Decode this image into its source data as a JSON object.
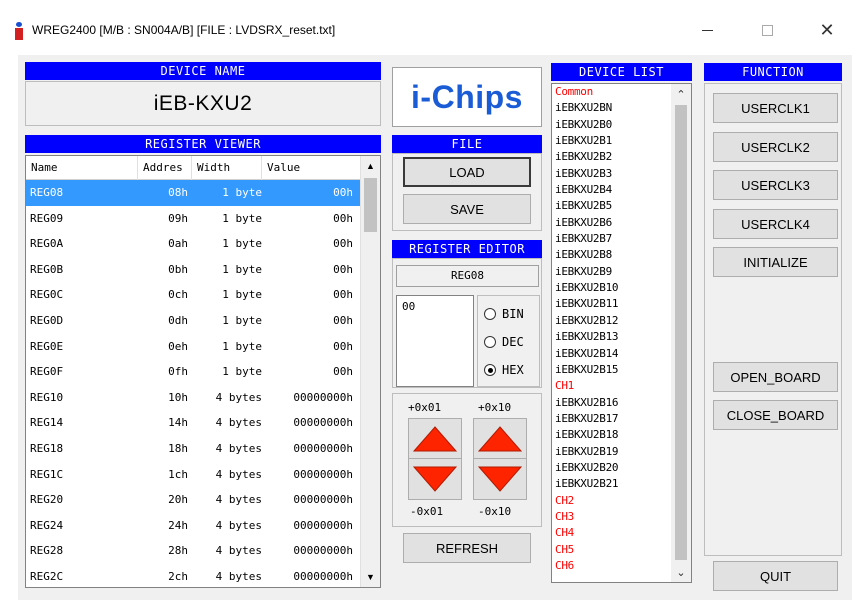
{
  "window": {
    "title": "WREG2400 [M/B : SN004A/B] [FILE : LVDSRX_reset.txt]",
    "minimize_glyph": "—",
    "maximize_glyph": "☐",
    "close_glyph": "✕"
  },
  "device_name": {
    "header": "DEVICE NAME",
    "value": "iEB-KXU2"
  },
  "logo": {
    "text": "i-Chips",
    "color": "#1a5bd6"
  },
  "register_viewer": {
    "header": "REGISTER VIEWER",
    "columns": [
      "Name",
      "Addres",
      "Width",
      "Value"
    ],
    "selected_index": 0,
    "rows": [
      {
        "name": "REG08",
        "addr": "08h",
        "width": "1 byte",
        "value": "00h"
      },
      {
        "name": "REG09",
        "addr": "09h",
        "width": "1 byte",
        "value": "00h"
      },
      {
        "name": "REG0A",
        "addr": "0ah",
        "width": "1 byte",
        "value": "00h"
      },
      {
        "name": "REG0B",
        "addr": "0bh",
        "width": "1 byte",
        "value": "00h"
      },
      {
        "name": "REG0C",
        "addr": "0ch",
        "width": "1 byte",
        "value": "00h"
      },
      {
        "name": "REG0D",
        "addr": "0dh",
        "width": "1 byte",
        "value": "00h"
      },
      {
        "name": "REG0E",
        "addr": "0eh",
        "width": "1 byte",
        "value": "00h"
      },
      {
        "name": "REG0F",
        "addr": "0fh",
        "width": "1 byte",
        "value": "00h"
      },
      {
        "name": "REG10",
        "addr": "10h",
        "width": "4 bytes",
        "value": "00000000h"
      },
      {
        "name": "REG14",
        "addr": "14h",
        "width": "4 bytes",
        "value": "00000000h"
      },
      {
        "name": "REG18",
        "addr": "18h",
        "width": "4 bytes",
        "value": "00000000h"
      },
      {
        "name": "REG1C",
        "addr": "1ch",
        "width": "4 bytes",
        "value": "00000000h"
      },
      {
        "name": "REG20",
        "addr": "20h",
        "width": "4 bytes",
        "value": "00000000h"
      },
      {
        "name": "REG24",
        "addr": "24h",
        "width": "4 bytes",
        "value": "00000000h"
      },
      {
        "name": "REG28",
        "addr": "28h",
        "width": "4 bytes",
        "value": "00000000h"
      },
      {
        "name": "REG2C",
        "addr": "2ch",
        "width": "4 bytes",
        "value": "00000000h"
      }
    ],
    "scroll_up_glyph": "▲",
    "scroll_down_glyph": "▼"
  },
  "file_panel": {
    "header": "FILE",
    "load_label": "LOAD",
    "save_label": "SAVE"
  },
  "register_editor": {
    "header": "REGISTER EDITOR",
    "register_name": "REG08",
    "edit_value": "00",
    "radix_options": [
      "BIN",
      "DEC",
      "HEX"
    ],
    "selected_radix": "HEX",
    "step_labels": {
      "inc_small": "+0x01",
      "inc_large": "+0x10",
      "dec_small": "-0x01",
      "dec_large": "-0x10"
    },
    "arrow_color": "#ff2400",
    "refresh_label": "REFRESH"
  },
  "device_list": {
    "header": "DEVICE LIST",
    "items": [
      {
        "label": "Common",
        "red": true
      },
      {
        "label": "iEBKXU2BN",
        "red": false
      },
      {
        "label": "iEBKXU2B0",
        "red": false
      },
      {
        "label": "iEBKXU2B1",
        "red": false
      },
      {
        "label": "iEBKXU2B2",
        "red": false
      },
      {
        "label": "iEBKXU2B3",
        "red": false
      },
      {
        "label": "iEBKXU2B4",
        "red": false
      },
      {
        "label": "iEBKXU2B5",
        "red": false
      },
      {
        "label": "iEBKXU2B6",
        "red": false
      },
      {
        "label": "iEBKXU2B7",
        "red": false
      },
      {
        "label": "iEBKXU2B8",
        "red": false
      },
      {
        "label": "iEBKXU2B9",
        "red": false
      },
      {
        "label": "iEBKXU2B10",
        "red": false
      },
      {
        "label": "iEBKXU2B11",
        "red": false
      },
      {
        "label": "iEBKXU2B12",
        "red": false
      },
      {
        "label": "iEBKXU2B13",
        "red": false
      },
      {
        "label": "iEBKXU2B14",
        "red": false
      },
      {
        "label": "iEBKXU2B15",
        "red": false
      },
      {
        "label": "CH1",
        "red": true
      },
      {
        "label": "iEBKXU2B16",
        "red": false
      },
      {
        "label": "iEBKXU2B17",
        "red": false
      },
      {
        "label": "iEBKXU2B18",
        "red": false
      },
      {
        "label": "iEBKXU2B19",
        "red": false
      },
      {
        "label": "iEBKXU2B20",
        "red": false
      },
      {
        "label": "iEBKXU2B21",
        "red": false
      },
      {
        "label": "CH2",
        "red": true
      },
      {
        "label": "CH3",
        "red": true
      },
      {
        "label": "CH4",
        "red": true
      },
      {
        "label": "CH5",
        "red": true
      },
      {
        "label": "CH6",
        "red": true
      }
    ],
    "scroll_up_glyph": "⌃",
    "scroll_down_glyph": "⌄"
  },
  "function_panel": {
    "header": "FUNCTION",
    "userclk1_label": "USERCLK1",
    "userclk2_label": "USERCLK2",
    "userclk3_label": "USERCLK3",
    "userclk4_label": "USERCLK4",
    "initialize_label": "INITIALIZE",
    "open_board_label": "OPEN_BOARD",
    "close_board_label": "CLOSE_BOARD",
    "quit_label": "QUIT"
  },
  "colors": {
    "header_blue": "#0000ff",
    "selection_blue": "#3399ff",
    "device_group_red": "#ff0000"
  }
}
